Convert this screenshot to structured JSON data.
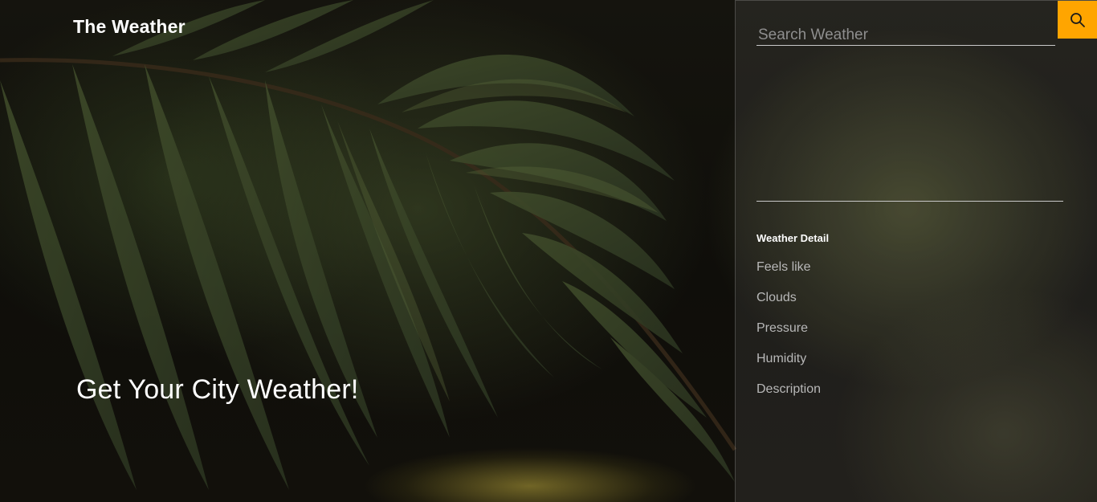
{
  "header": {
    "brand": "The Weather"
  },
  "hero": {
    "title": "Get Your City Weather!"
  },
  "search": {
    "placeholder": "Search Weather",
    "value": "",
    "button_icon": "search-icon",
    "button_color": "#ffa500"
  },
  "details": {
    "title": "Weather Detail",
    "items": [
      {
        "label": "Feels like"
      },
      {
        "label": "Clouds"
      },
      {
        "label": "Pressure"
      },
      {
        "label": "Humidity"
      },
      {
        "label": "Description"
      }
    ]
  }
}
